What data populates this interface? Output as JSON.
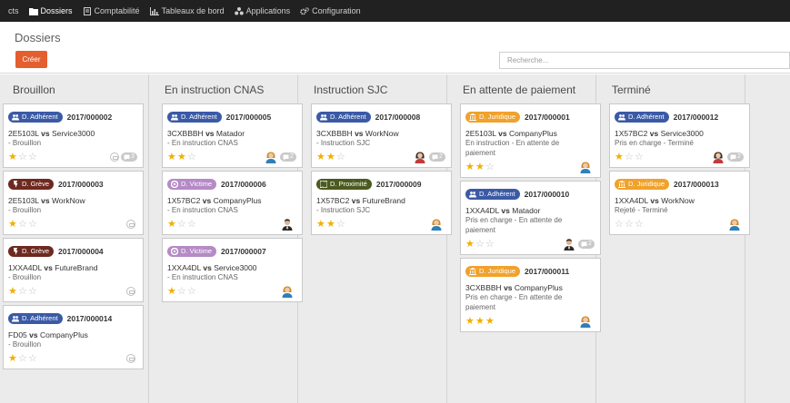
{
  "nav": {
    "items": [
      {
        "label": "cts",
        "icon": "",
        "active": false
      },
      {
        "label": "Dossiers",
        "icon": "folder-icon",
        "active": true
      },
      {
        "label": "Comptabilité",
        "icon": "document-icon",
        "active": false
      },
      {
        "label": "Tableaux de bord",
        "icon": "chart-icon",
        "active": false
      },
      {
        "label": "Applications",
        "icon": "apps-icon",
        "active": false
      },
      {
        "label": "Configuration",
        "icon": "gears-icon",
        "active": false
      }
    ]
  },
  "control": {
    "title": "Dossiers",
    "create_label": "Créer",
    "search_placeholder": "Recherche..."
  },
  "colors": {
    "adherent": "#3b5aa6",
    "greve": "#6e2a20",
    "victime": "#b58ac6",
    "juridique": "#f0a22c",
    "proximite": "#4b5a1e",
    "create_button": "#e45e2f",
    "star": "#f0b000"
  },
  "columns": [
    {
      "title": "Brouillon",
      "cards": [
        {
          "tag": "D. Adhérent",
          "type": "adherent",
          "ref": "2017/000002",
          "party_a": "2E5103L",
          "vs": "vs",
          "party_b": "Service3000",
          "status": [
            "- Brouillon"
          ],
          "stars": 1,
          "avatar": false,
          "ghost": true,
          "badge": "3"
        },
        {
          "tag": "D. Grève",
          "type": "greve",
          "ref": "2017/000003",
          "party_a": "2E5103L",
          "vs": "vs",
          "party_b": "WorkNow",
          "status": [
            "- Brouillon"
          ],
          "stars": 1,
          "avatar": false,
          "ghost": true,
          "badge": ""
        },
        {
          "tag": "D. Grève",
          "type": "greve",
          "ref": "2017/000004",
          "party_a": "1XXA4DL",
          "vs": "vs",
          "party_b": "FutureBrand",
          "status": [
            "- Brouillon"
          ],
          "stars": 1,
          "avatar": false,
          "ghost": true,
          "badge": ""
        },
        {
          "tag": "D. Adhérent",
          "type": "adherent",
          "ref": "2017/000014",
          "party_a": "FD05",
          "vs": "vs",
          "party_b": "CompanyPlus",
          "status": [
            "- Brouillon"
          ],
          "stars": 1,
          "avatar": false,
          "ghost": true,
          "badge": ""
        }
      ]
    },
    {
      "title": "En instruction CNAS",
      "cards": [
        {
          "tag": "D. Adhérent",
          "type": "adherent",
          "ref": "2017/000005",
          "party_a": "3CXBBBH",
          "vs": "vs",
          "party_b": "Matador",
          "status": [
            "- En instruction CNAS"
          ],
          "stars": 2,
          "avatar": "woman",
          "ghost": false,
          "badge": "2"
        },
        {
          "tag": "D. Victime",
          "type": "victime",
          "ref": "2017/000006",
          "party_a": "1X57BC2",
          "vs": "vs",
          "party_b": "CompanyPlus",
          "status": [
            "- En instruction CNAS"
          ],
          "stars": 1,
          "avatar": "man",
          "ghost": false,
          "badge": ""
        },
        {
          "tag": "D. Victime",
          "type": "victime",
          "ref": "2017/000007",
          "party_a": "1XXA4DL",
          "vs": "vs",
          "party_b": "Service3000",
          "status": [
            "- En instruction CNAS"
          ],
          "stars": 1,
          "avatar": "woman",
          "ghost": false,
          "badge": ""
        }
      ]
    },
    {
      "title": "Instruction SJC",
      "cards": [
        {
          "tag": "D. Adhérent",
          "type": "adherent",
          "ref": "2017/000008",
          "party_a": "3CXBBBH",
          "vs": "vs",
          "party_b": "WorkNow",
          "status": [
            "- Instruction SJC"
          ],
          "stars": 2,
          "avatar": "woman2",
          "ghost": false,
          "badge": "2"
        },
        {
          "tag": "D. Proximité",
          "type": "proximite",
          "ref": "2017/000009",
          "party_a": "1X57BC2",
          "vs": "vs",
          "party_b": "FutureBrand",
          "status": [
            "- Instruction SJC"
          ],
          "stars": 2,
          "avatar": "woman",
          "ghost": false,
          "badge": ""
        }
      ]
    },
    {
      "title": "En attente de paiement",
      "cards": [
        {
          "tag": "D. Juridique",
          "type": "juridique",
          "ref": "2017/000001",
          "party_a": "2E5103L",
          "vs": "vs",
          "party_b": "CompanyPlus",
          "status": [
            "En instruction - En attente de",
            "paiement"
          ],
          "stars": 2,
          "avatar": "woman",
          "ghost": false,
          "badge": ""
        },
        {
          "tag": "D. Adhérent",
          "type": "adherent",
          "ref": "2017/000010",
          "party_a": "1XXA4DL",
          "vs": "vs",
          "party_b": "Matador",
          "status": [
            "Pris en charge - En attente de",
            "paiement"
          ],
          "stars": 1,
          "avatar": "man",
          "ghost": false,
          "badge": "2"
        },
        {
          "tag": "D. Juridique",
          "type": "juridique",
          "ref": "2017/000011",
          "party_a": "3CXBBBH",
          "vs": "vs",
          "party_b": "CompanyPlus",
          "status": [
            "Pris en charge - En attente de",
            "paiement"
          ],
          "stars": 3,
          "avatar": "woman",
          "ghost": false,
          "badge": ""
        }
      ]
    },
    {
      "title": "Terminé",
      "cards": [
        {
          "tag": "D. Adhérent",
          "type": "adherent",
          "ref": "2017/000012",
          "party_a": "1X57BC2",
          "vs": "vs",
          "party_b": "Service3000",
          "status": [
            "Pris en charge - Terminé"
          ],
          "stars": 1,
          "avatar": "woman2",
          "ghost": false,
          "badge": "2"
        },
        {
          "tag": "D. Juridique",
          "type": "juridique",
          "ref": "2017/000013",
          "party_a": "1XXA4DL",
          "vs": "vs",
          "party_b": "WorkNow",
          "status": [
            "Rejeté - Terminé"
          ],
          "stars": 0,
          "avatar": "woman",
          "ghost": false,
          "badge": ""
        }
      ]
    }
  ]
}
